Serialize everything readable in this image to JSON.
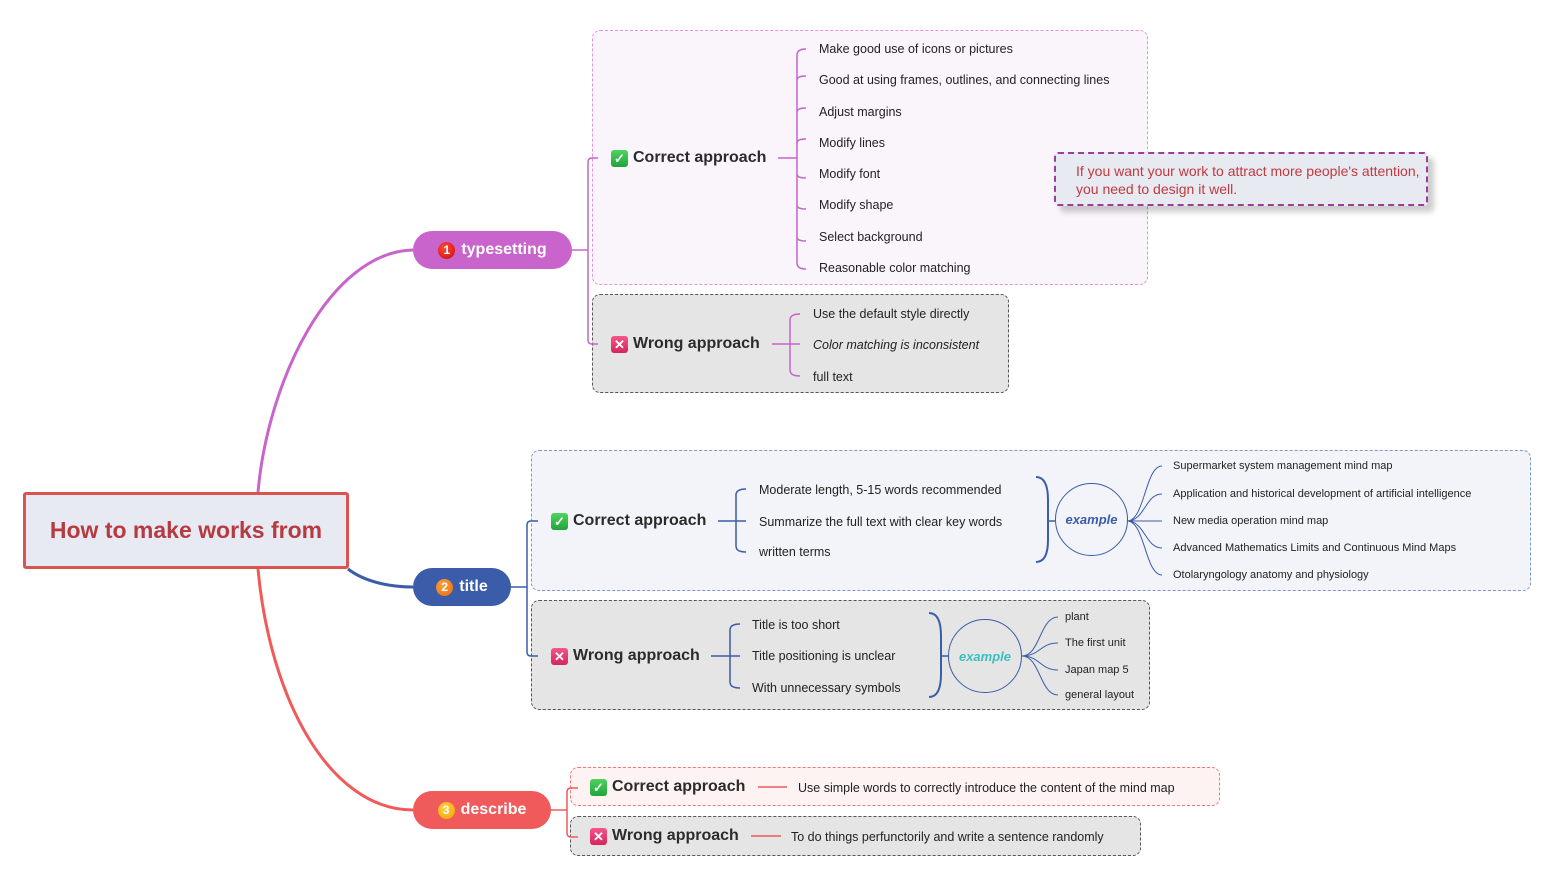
{
  "root": {
    "title": "How to make works from"
  },
  "colors": {
    "typesetting": "#c864cc",
    "title": "#3b5ca8",
    "describe": "#f05a5a",
    "root_border": "#d9534f"
  },
  "branches": [
    {
      "label": "typesetting",
      "number": "1",
      "correct": {
        "label": "Correct approach",
        "items": [
          "Make good use of icons or pictures",
          "Good at using frames, outlines, and connecting lines",
          "Adjust margins",
          "Modify lines",
          "Modify font",
          "Modify shape",
          "Select background",
          "Reasonable color matching"
        ],
        "note": "If you want your work to attract more people's attention, you need to design it well."
      },
      "wrong": {
        "label": "Wrong approach",
        "items": [
          "Use the default style directly",
          "Color matching is inconsistent",
          "full text"
        ]
      }
    },
    {
      "label": "title",
      "number": "2",
      "correct": {
        "label": "Correct approach",
        "items": [
          "Moderate length, 5-15 words recommended",
          "Summarize the full text with clear key words",
          "written terms"
        ],
        "example_label": "example",
        "examples": [
          "Supermarket system management mind map",
          "Application and historical development of artificial intelligence",
          "New media operation mind map",
          "Advanced Mathematics Limits and Continuous Mind Maps",
          "Otolaryngology anatomy and physiology"
        ]
      },
      "wrong": {
        "label": "Wrong approach",
        "items": [
          "Title is too short",
          "Title positioning is unclear",
          "With unnecessary symbols"
        ],
        "example_label": "example",
        "examples": [
          "plant",
          "The first unit",
          "Japan map 5",
          "general layout"
        ]
      }
    },
    {
      "label": "describe",
      "number": "3",
      "correct": {
        "label": "Correct approach",
        "items": [
          "Use simple words to correctly introduce the content of the mind map"
        ]
      },
      "wrong": {
        "label": "Wrong approach",
        "items": [
          "To do things perfunctorily and write a sentence randomly"
        ]
      }
    }
  ],
  "icons": {
    "correct": "check-icon",
    "wrong": "cross-icon"
  }
}
